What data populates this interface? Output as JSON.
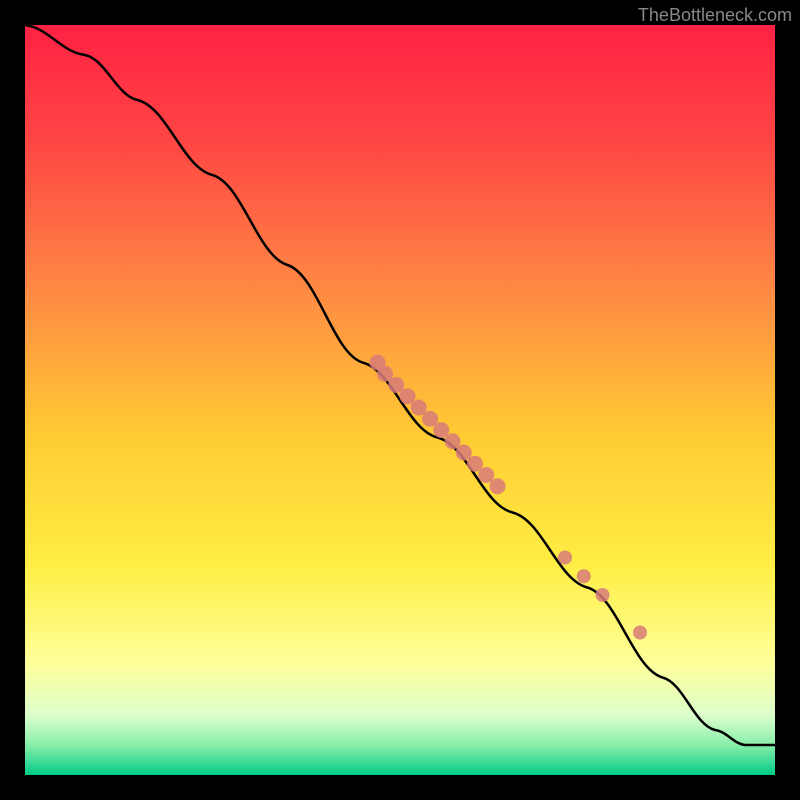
{
  "watermark": "TheBottleneck.com",
  "chart_data": {
    "type": "line",
    "title": "",
    "xlabel": "",
    "ylabel": "",
    "description": "Performance bottleneck curve with gradient background from red (top/high bottleneck) through yellow to green (bottom/low bottleneck)",
    "curve_points": [
      {
        "x": 0.0,
        "y": 1.0
      },
      {
        "x": 0.08,
        "y": 0.96
      },
      {
        "x": 0.15,
        "y": 0.9
      },
      {
        "x": 0.25,
        "y": 0.8
      },
      {
        "x": 0.35,
        "y": 0.68
      },
      {
        "x": 0.45,
        "y": 0.55
      },
      {
        "x": 0.55,
        "y": 0.45
      },
      {
        "x": 0.65,
        "y": 0.35
      },
      {
        "x": 0.75,
        "y": 0.25
      },
      {
        "x": 0.85,
        "y": 0.13
      },
      {
        "x": 0.92,
        "y": 0.06
      },
      {
        "x": 0.96,
        "y": 0.04
      },
      {
        "x": 1.0,
        "y": 0.04
      }
    ],
    "highlighted_points": [
      {
        "x": 0.47,
        "y": 0.55,
        "size": 8
      },
      {
        "x": 0.48,
        "y": 0.535,
        "size": 8
      },
      {
        "x": 0.495,
        "y": 0.52,
        "size": 8
      },
      {
        "x": 0.51,
        "y": 0.505,
        "size": 8
      },
      {
        "x": 0.525,
        "y": 0.49,
        "size": 8
      },
      {
        "x": 0.54,
        "y": 0.475,
        "size": 8
      },
      {
        "x": 0.555,
        "y": 0.46,
        "size": 8
      },
      {
        "x": 0.57,
        "y": 0.445,
        "size": 8
      },
      {
        "x": 0.585,
        "y": 0.43,
        "size": 8
      },
      {
        "x": 0.6,
        "y": 0.415,
        "size": 8
      },
      {
        "x": 0.615,
        "y": 0.4,
        "size": 8
      },
      {
        "x": 0.63,
        "y": 0.385,
        "size": 8
      },
      {
        "x": 0.72,
        "y": 0.29,
        "size": 7
      },
      {
        "x": 0.745,
        "y": 0.265,
        "size": 7
      },
      {
        "x": 0.77,
        "y": 0.24,
        "size": 7
      },
      {
        "x": 0.82,
        "y": 0.19,
        "size": 7
      }
    ],
    "gradient_stops": [
      {
        "offset": 0.0,
        "color": "#FF2244"
      },
      {
        "offset": 0.15,
        "color": "#FF4444"
      },
      {
        "offset": 0.35,
        "color": "#FF8844"
      },
      {
        "offset": 0.55,
        "color": "#FFCC33"
      },
      {
        "offset": 0.72,
        "color": "#FFEE44"
      },
      {
        "offset": 0.85,
        "color": "#FFFF99"
      },
      {
        "offset": 0.92,
        "color": "#DDFFCC"
      },
      {
        "offset": 0.96,
        "color": "#88EEAA"
      },
      {
        "offset": 0.98,
        "color": "#44DD99"
      },
      {
        "offset": 1.0,
        "color": "#00CC88"
      }
    ]
  }
}
